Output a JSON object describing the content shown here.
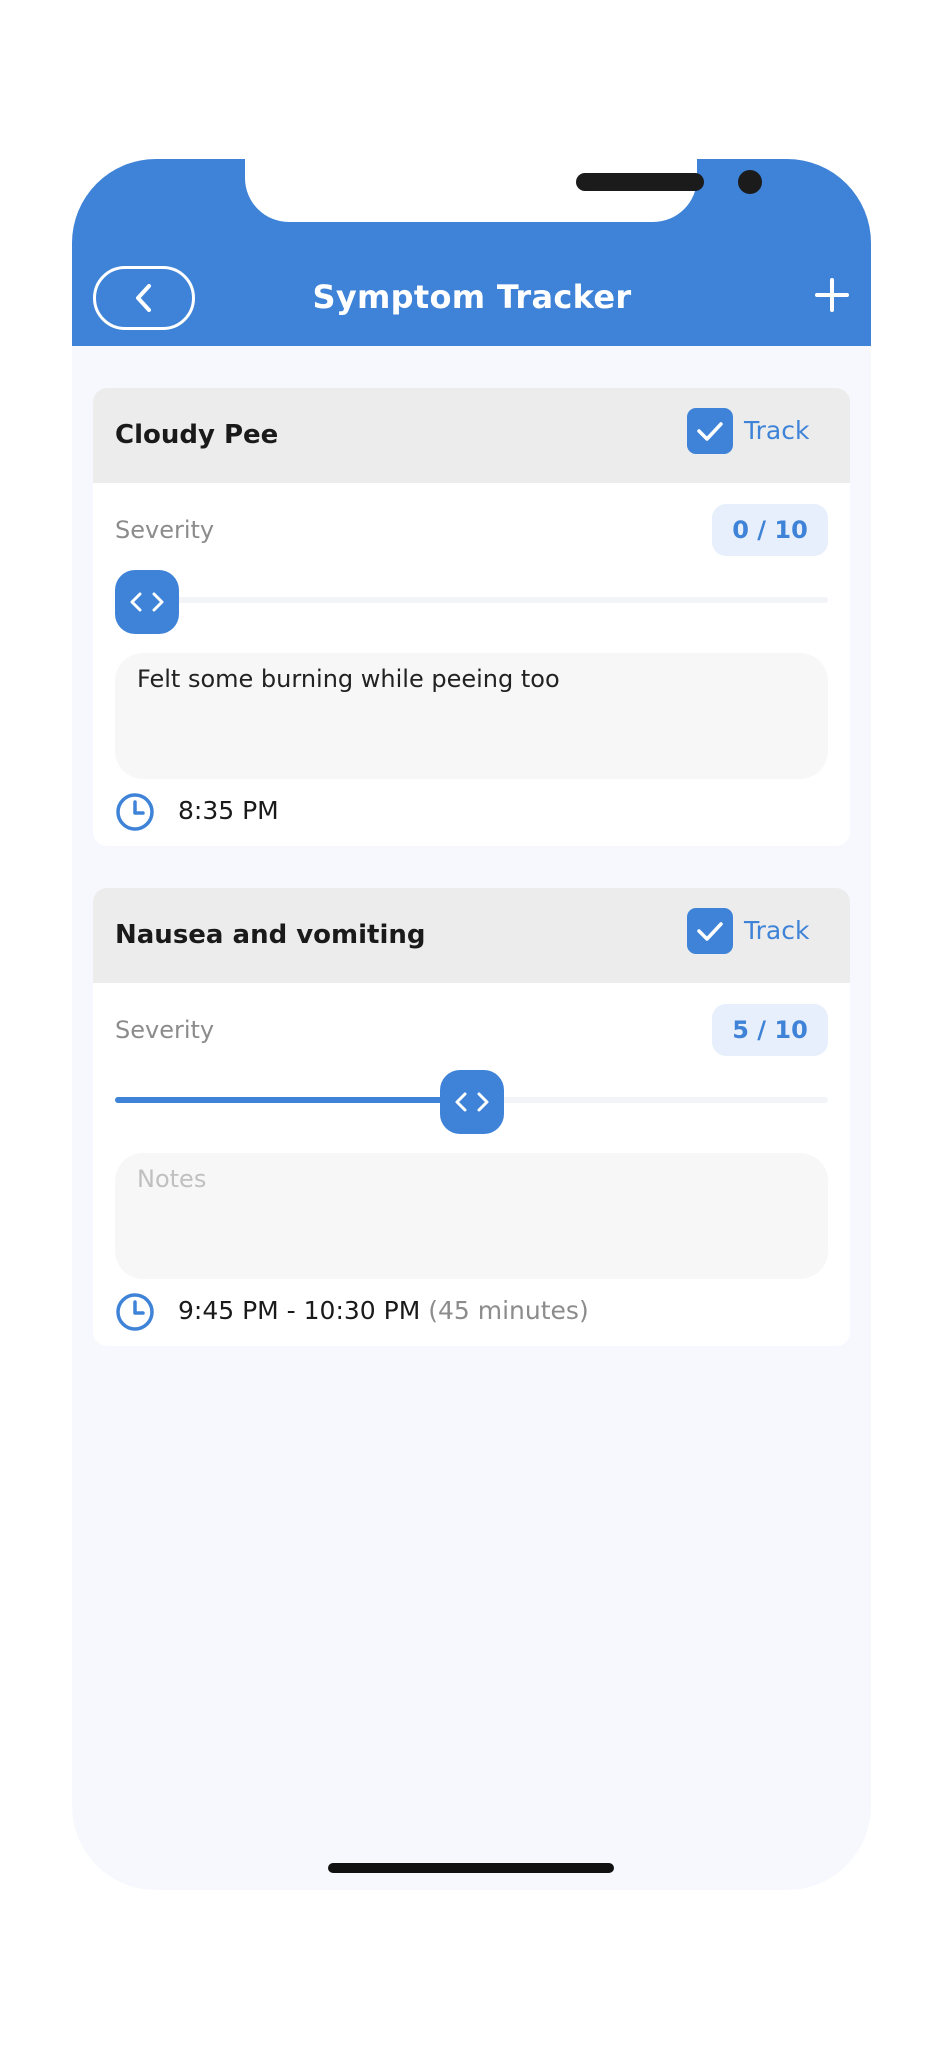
{
  "header": {
    "title": "Symptom Tracker",
    "back_icon": "chevron-left-icon",
    "add_icon": "plus-icon",
    "color": "#3e83d7"
  },
  "symptoms": [
    {
      "name": "Cloudy Pee",
      "tracked": true,
      "track_label": "Track",
      "severity_label": "Severity",
      "severity_value": 0,
      "severity_max": 10,
      "severity_text": "0 / 10",
      "notes": "Felt some burning while peeing too",
      "notes_placeholder": "Notes",
      "time": "8:35 PM",
      "duration": ""
    },
    {
      "name": "Nausea and vomiting",
      "tracked": true,
      "track_label": "Track",
      "severity_label": "Severity",
      "severity_value": 5,
      "severity_max": 10,
      "severity_text": "5 / 10",
      "notes": "",
      "notes_placeholder": "Notes",
      "time": "9:45 PM - 10:30 PM",
      "duration": "(45 minutes)"
    }
  ]
}
